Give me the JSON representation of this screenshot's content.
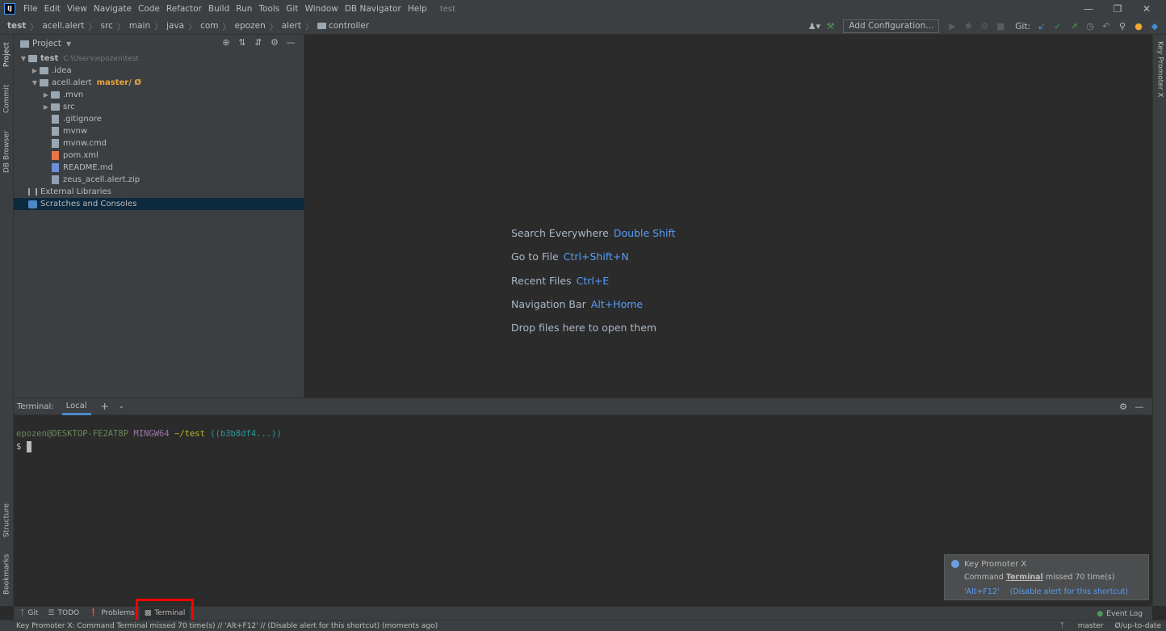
{
  "menubar": {
    "items": [
      "File",
      "Edit",
      "View",
      "Navigate",
      "Code",
      "Refactor",
      "Build",
      "Run",
      "Tools",
      "Git",
      "Window",
      "DB Navigator",
      "Help"
    ],
    "project_name": "test"
  },
  "navbar": {
    "crumbs": [
      "test",
      "acell.alert",
      "src",
      "main",
      "java",
      "com",
      "epozen",
      "alert",
      "controller"
    ],
    "add_configuration": "Add Configuration...",
    "git_label": "Git:"
  },
  "left_tabs": [
    "Project",
    "Commit",
    "DB Browser",
    "Structure",
    "Bookmarks"
  ],
  "right_tabs": [
    "Key Promoter X"
  ],
  "project_panel": {
    "title": "Project",
    "tree": [
      {
        "label": "test",
        "path": "C:\\Users\\epozen\\test",
        "depth": 0
      },
      {
        "label": ".idea",
        "depth": 1
      },
      {
        "label": "acell.alert",
        "branch": "master/ Ø",
        "depth": 1
      },
      {
        "label": ".mvn",
        "depth": 2
      },
      {
        "label": "src",
        "depth": 2
      },
      {
        "label": ".gitignore",
        "depth": 2
      },
      {
        "label": "mvnw",
        "depth": 2
      },
      {
        "label": "mvnw.cmd",
        "depth": 2
      },
      {
        "label": "pom.xml",
        "depth": 2
      },
      {
        "label": "README.md",
        "depth": 2
      },
      {
        "label": "zeus_acell.alert.zip",
        "depth": 2
      },
      {
        "label": "External Libraries",
        "depth": 0
      },
      {
        "label": "Scratches and Consoles",
        "depth": 0
      }
    ]
  },
  "editor_hints": [
    {
      "label": "Search Everywhere",
      "key": "Double Shift"
    },
    {
      "label": "Go to File",
      "key": "Ctrl+Shift+N"
    },
    {
      "label": "Recent Files",
      "key": "Ctrl+E"
    },
    {
      "label": "Navigation Bar",
      "key": "Alt+Home"
    },
    {
      "label": "Drop files here to open them",
      "key": ""
    }
  ],
  "terminal": {
    "label": "Terminal:",
    "tab": "Local",
    "prompt_user": "epozen@DESKTOP-FE2AT8P",
    "prompt_host": "MINGW64",
    "prompt_dir": "~/test",
    "prompt_branch": "((b3b8df4...))",
    "prompt_symbol": "$"
  },
  "notification": {
    "title": "Key Promoter X",
    "msg_prefix": "Command",
    "msg_command": "Terminal",
    "msg_suffix": "missed 70 time(s)",
    "link_shortcut": "'Alt+F12'",
    "link_disable": "(Disable alert for this shortcut)"
  },
  "tool_tabs": {
    "git": "Git",
    "todo": "TODO",
    "problems": "Problems",
    "terminal": "Terminal",
    "event_log": "Event Log"
  },
  "statusbar": {
    "message": "Key Promoter X: Command Terminal missed 70 time(s) // 'Alt+F12' // (Disable alert for this shortcut) (moments ago)",
    "branch": "master",
    "sync": "Ø/up-to-date"
  }
}
